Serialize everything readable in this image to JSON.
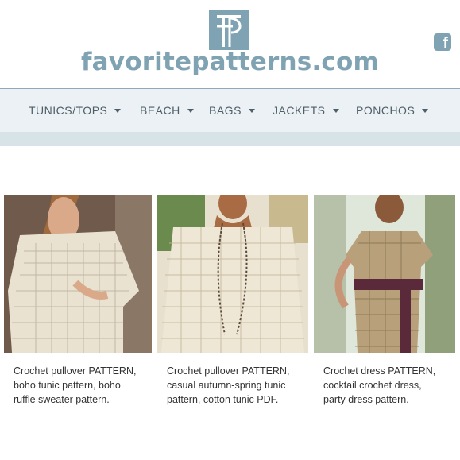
{
  "header": {
    "site_name": "favoritepatterns.com",
    "logo_icon": "fp-monogram-logo",
    "social_icon": "facebook-icon",
    "social_glyph": "f"
  },
  "nav": {
    "items": [
      {
        "label": "TUNICS/TOPS"
      },
      {
        "label": "BEACH"
      },
      {
        "label": "BAGS"
      },
      {
        "label": "JACKETS"
      },
      {
        "label": "PONCHOS"
      }
    ]
  },
  "products": [
    {
      "title_lines": [
        "Crochet pullover PATTERN,",
        "boho tunic pattern, boho",
        "ruffle sweater pattern."
      ]
    },
    {
      "title_lines": [
        "Crochet pullover PATTERN,",
        "casual autumn-spring tunic",
        "pattern, cotton tunic PDF."
      ]
    },
    {
      "title_lines": [
        "Crochet dress PATTERN,",
        "cocktail crochet dress,",
        "party dress pattern."
      ]
    }
  ],
  "colors": {
    "brand": "#7fa3b3",
    "nav_bg": "#ebf1f4",
    "subbar_bg": "#d8e3e8",
    "nav_text": "#4f5f68"
  }
}
